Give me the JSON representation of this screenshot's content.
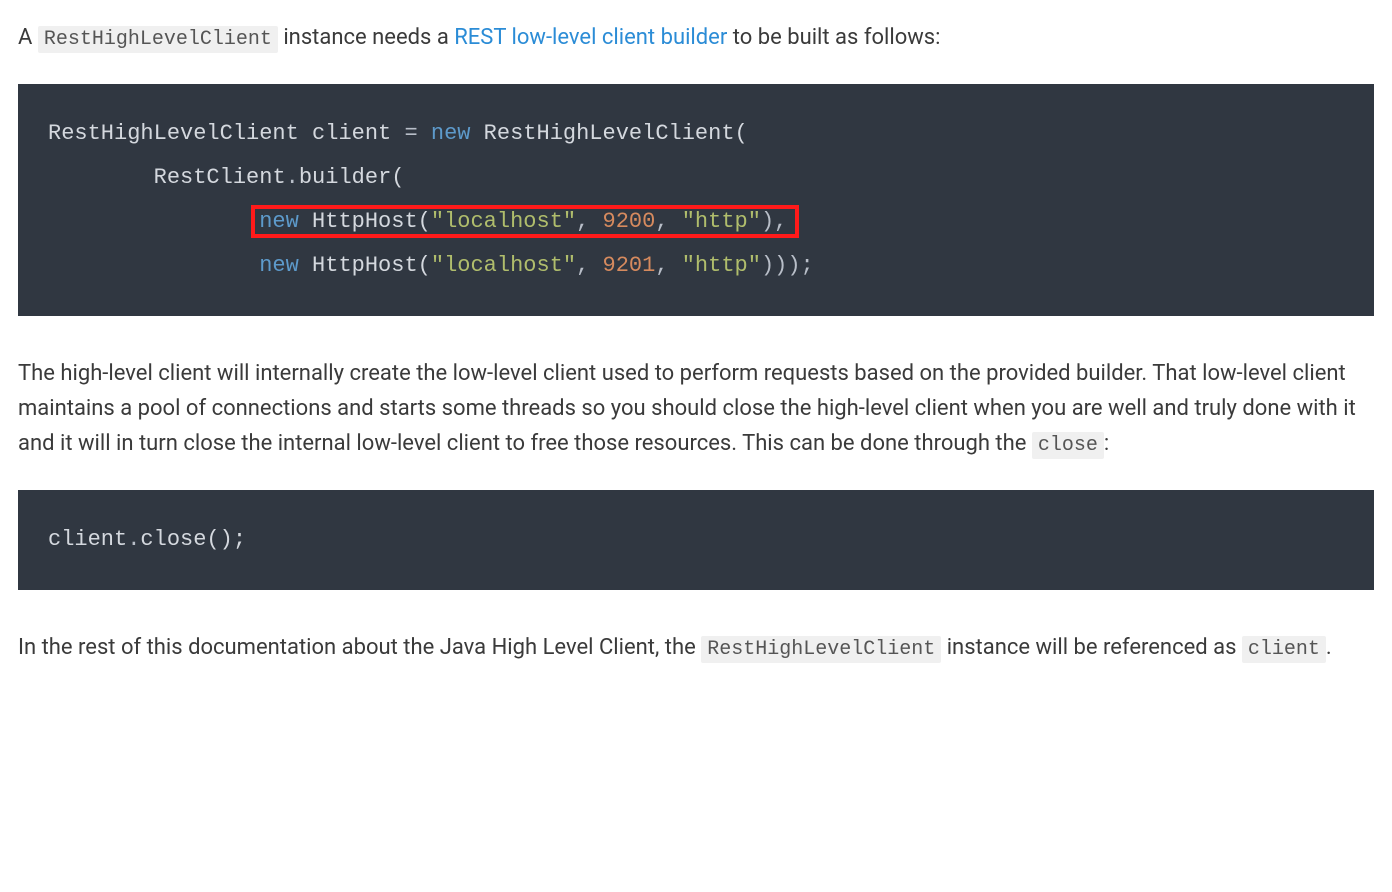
{
  "para1": {
    "pre": "A ",
    "code1": "RestHighLevelClient",
    "mid": " instance needs a ",
    "link": "REST low-level client builder",
    "post": " to be built as follows:"
  },
  "code_block1": {
    "line1": {
      "t1": "RestHighLevelClient client ",
      "op": "=",
      "sp": " ",
      "kw": "new",
      "t2": " RestHighLevelClient("
    },
    "line2": {
      "indent": "        ",
      "t1": "RestClient",
      "dot": ".",
      "t2": "builder("
    },
    "line3": {
      "indent": "                ",
      "kw": "new",
      "sp": " ",
      "t1": "HttpHost(",
      "s1": "\"localhost\"",
      "c1": ",",
      "sp2": " ",
      "n1": "9200",
      "c2": ",",
      "sp3": " ",
      "s2": "\"http\"",
      "t2": "),"
    },
    "line4": {
      "indent": "                ",
      "kw": "new",
      "sp": " ",
      "t1": "HttpHost(",
      "s1": "\"localhost\"",
      "c1": ",",
      "sp2": " ",
      "n1": "9201",
      "c2": ",",
      "sp3": " ",
      "s2": "\"http\"",
      "t2": ")));"
    }
  },
  "para2": {
    "t1": "The high-level client will internally create the low-level client used to perform requests based on the provided builder. That low-level client maintains a pool of connections and starts some threads so you should close the high-level client when you are well and truly done with it and it will in turn close the internal low-level client to free those resources. This can be done through the ",
    "code": "close",
    "t2": ":"
  },
  "code_block2": {
    "t1": "client",
    "dot": ".",
    "t2": "close();"
  },
  "para3": {
    "t1": "In the rest of this documentation about the Java High Level Client, the ",
    "code1": "RestHighLevelClient",
    "t2": " instance will be referenced as ",
    "code2": "client",
    "t3": "."
  }
}
